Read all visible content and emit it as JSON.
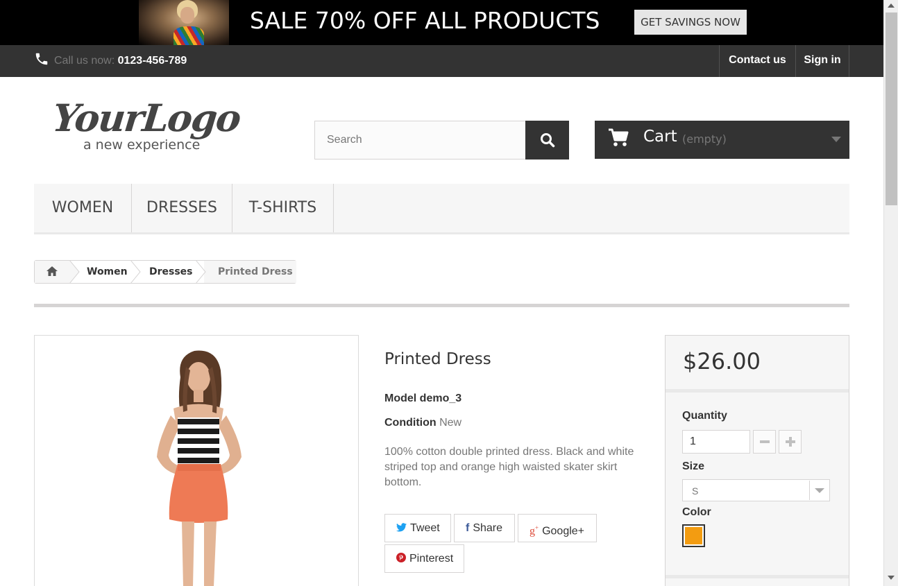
{
  "banner": {
    "title": "SALE 70% OFF ALL PRODUCTS",
    "button_label": "GET SAVINGS NOW"
  },
  "topbar": {
    "call_prefix": "Call us now: ",
    "phone": "0123-456-789",
    "contact_label": "Contact us",
    "signin_label": "Sign in"
  },
  "logo": {
    "main": "YourLogo",
    "tagline": "a new experience"
  },
  "search": {
    "placeholder": "Search"
  },
  "cart": {
    "label": "Cart",
    "status": "(empty)"
  },
  "menu": {
    "items": [
      "WOMEN",
      "DRESSES",
      "T-SHIRTS"
    ]
  },
  "breadcrumb": {
    "items": [
      "Women",
      "Dresses",
      "Printed Dress"
    ]
  },
  "product": {
    "name": "Printed Dress",
    "model": "Model demo_3",
    "condition_label": "Condition",
    "condition_value": "New",
    "description": "100% cotton double printed dress. Black and white striped top and orange high waisted skater skirt bottom.",
    "social": {
      "tweet": "Tweet",
      "share": "Share",
      "googleplus": "Google+",
      "pinterest": "Pinterest"
    }
  },
  "buy": {
    "price": "$26.00",
    "quantity_label": "Quantity",
    "quantity_value": "1",
    "size_label": "Size",
    "size_value": "S",
    "color_label": "Color",
    "color_swatch": "#f39c11"
  },
  "colors": {
    "dark": "#333333",
    "muted": "#777777",
    "swatch_orange": "#f39c11"
  }
}
